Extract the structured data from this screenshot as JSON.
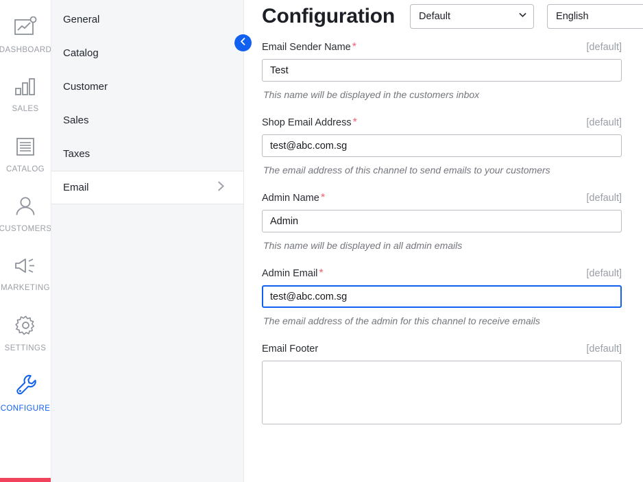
{
  "rail": {
    "items": [
      {
        "label": "DASHBOARD",
        "icon": "dashboard-icon",
        "active": false
      },
      {
        "label": "SALES",
        "icon": "sales-bar-chart-icon",
        "active": false
      },
      {
        "label": "CATALOG",
        "icon": "catalog-list-icon",
        "active": false
      },
      {
        "label": "CUSTOMERS",
        "icon": "customers-person-icon",
        "active": false
      },
      {
        "label": "MARKETING",
        "icon": "marketing-megaphone-icon",
        "active": false
      },
      {
        "label": "SETTINGS",
        "icon": "settings-gear-icon",
        "active": false
      },
      {
        "label": "CONFIGURE",
        "icon": "configure-wrench-icon",
        "active": true
      }
    ],
    "accent_color": "#1160f0",
    "inactive_color": "#9a9ea6",
    "bottom_bar_color": "#f0445c"
  },
  "subnav": {
    "items": [
      {
        "label": "General",
        "active": false
      },
      {
        "label": "Catalog",
        "active": false
      },
      {
        "label": "Customer",
        "active": false
      },
      {
        "label": "Sales",
        "active": false
      },
      {
        "label": "Taxes",
        "active": false
      },
      {
        "label": "Email",
        "active": true
      }
    ],
    "collapse_button": {
      "icon": "chevron-left-icon",
      "color": "#1160f0"
    }
  },
  "header": {
    "title": "Configuration",
    "channel_select": {
      "value": "Default",
      "options": [
        "Default"
      ]
    },
    "language_select": {
      "value": "English",
      "options": [
        "English"
      ]
    }
  },
  "form": {
    "default_badge": "[default]",
    "required_marker": "*",
    "fields": [
      {
        "label": "Email Sender Name",
        "required": true,
        "default_badge": "[default]",
        "value": "Test",
        "placeholder": "",
        "hint": "This name will be displayed in the customers inbox",
        "focused": false,
        "type": "text"
      },
      {
        "label": "Shop Email Address",
        "required": true,
        "default_badge": "[default]",
        "value": "test@abc.com.sg",
        "placeholder": "",
        "hint": "The email address of this channel to send emails to your customers",
        "focused": false,
        "type": "text"
      },
      {
        "label": "Admin Name",
        "required": true,
        "default_badge": "[default]",
        "value": "Admin",
        "placeholder": "",
        "hint": "This name will be displayed in all admin emails",
        "focused": false,
        "type": "text"
      },
      {
        "label": "Admin Email",
        "required": true,
        "default_badge": "[default]",
        "value": "test@abc.com.sg",
        "placeholder": "",
        "hint": "The email address of the admin for this channel to receive emails",
        "focused": true,
        "type": "text"
      },
      {
        "label": "Email Footer",
        "required": false,
        "default_badge": "[default]",
        "value": "",
        "placeholder": "",
        "hint": "",
        "focused": false,
        "type": "textarea"
      }
    ]
  }
}
